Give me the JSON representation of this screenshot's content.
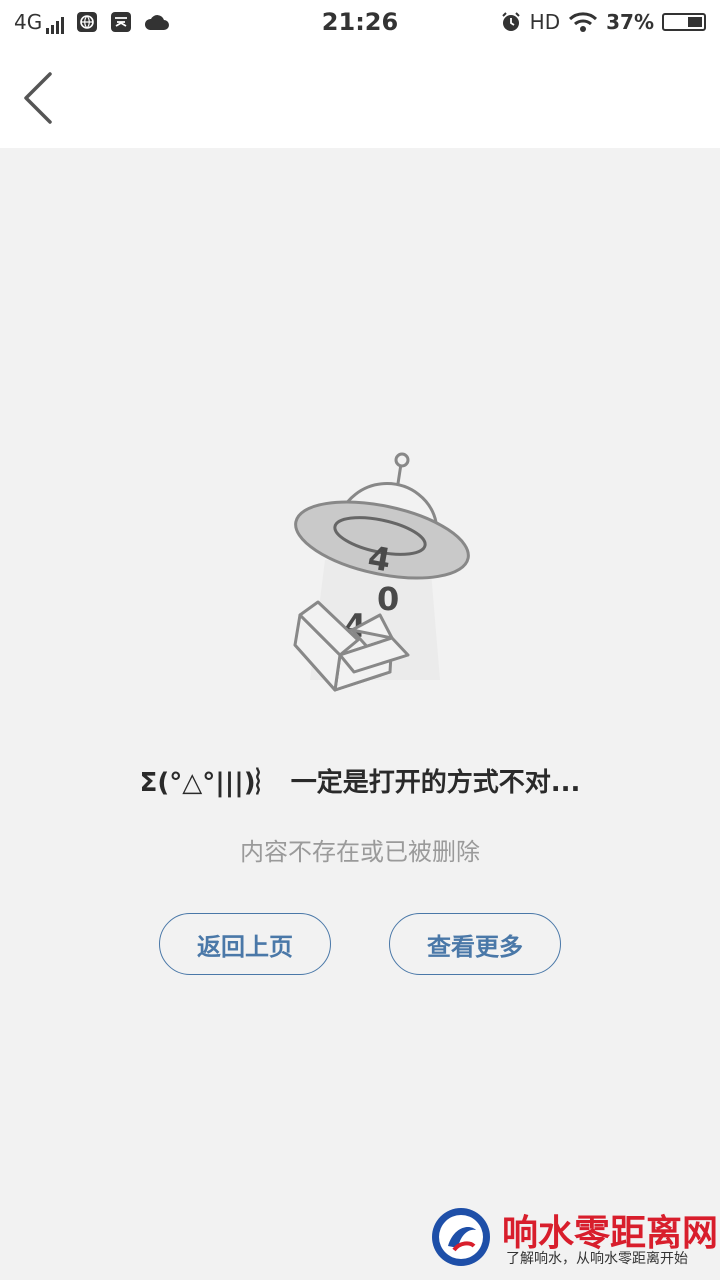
{
  "status_bar": {
    "network": "4G",
    "time": "21:26",
    "hd": "HD",
    "battery": "37%"
  },
  "header": {
    "back_icon": "chevron-left-icon"
  },
  "illustration": {
    "digit_1": "4",
    "digit_2": "0",
    "digit_3": "4"
  },
  "message": {
    "title": "Σ(°△°|||)︴ 一定是打开的方式不对...",
    "subtitle": "内容不存在或已被删除"
  },
  "buttons": {
    "back_label": "返回上页",
    "more_label": "查看更多"
  },
  "watermark": {
    "title": "响水零距离网",
    "subtitle": "了解响水，从响水零距离开始"
  },
  "colors": {
    "accent": "#4a78a8",
    "background": "#f2f2f2",
    "watermark_red": "#d81e2c"
  }
}
